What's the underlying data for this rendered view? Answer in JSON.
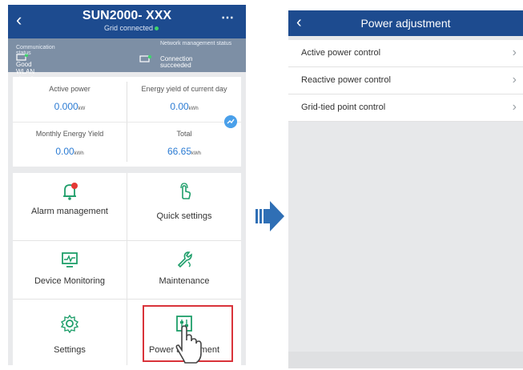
{
  "left_screen": {
    "header": {
      "title": "SUN2000- XXX",
      "subtitle": "Grid connected"
    },
    "status": {
      "communication": {
        "label": "Communication status",
        "value": "Good WLAN signal"
      },
      "network": {
        "label": "Network management status",
        "value": "Connection succeeded"
      }
    },
    "kpis": [
      {
        "label": "Active power",
        "value": "0.000",
        "unit": "kW"
      },
      {
        "label": "Energy yield of current day",
        "value": "0.00",
        "unit": "kWh"
      },
      {
        "label": "Monthly Energy Yield",
        "value": "0.00",
        "unit": "kWh"
      },
      {
        "label": "Total",
        "value": "66.65",
        "unit": "kWh"
      }
    ],
    "menu": [
      {
        "label": "Alarm management",
        "icon": "alarm-bell-icon"
      },
      {
        "label": "Quick settings",
        "icon": "touch-hand-icon"
      },
      {
        "label": "Device Monitoring",
        "icon": "monitor-icon"
      },
      {
        "label": "Maintenance",
        "icon": "wrench-icon"
      },
      {
        "label": "Settings",
        "icon": "gear-icon"
      },
      {
        "label": "Power adjustment",
        "icon": "power-adjust-icon"
      }
    ],
    "alarm_badge": "",
    "accent": "#1d4b8f",
    "highlight_color": "#d9333a"
  },
  "right_screen": {
    "header": {
      "title": "Power adjustment"
    },
    "items": [
      {
        "label": "Active power control"
      },
      {
        "label": "Reactive power control"
      },
      {
        "label": "Grid-tied point control"
      }
    ]
  },
  "arrow_color": "#2f6fb5"
}
